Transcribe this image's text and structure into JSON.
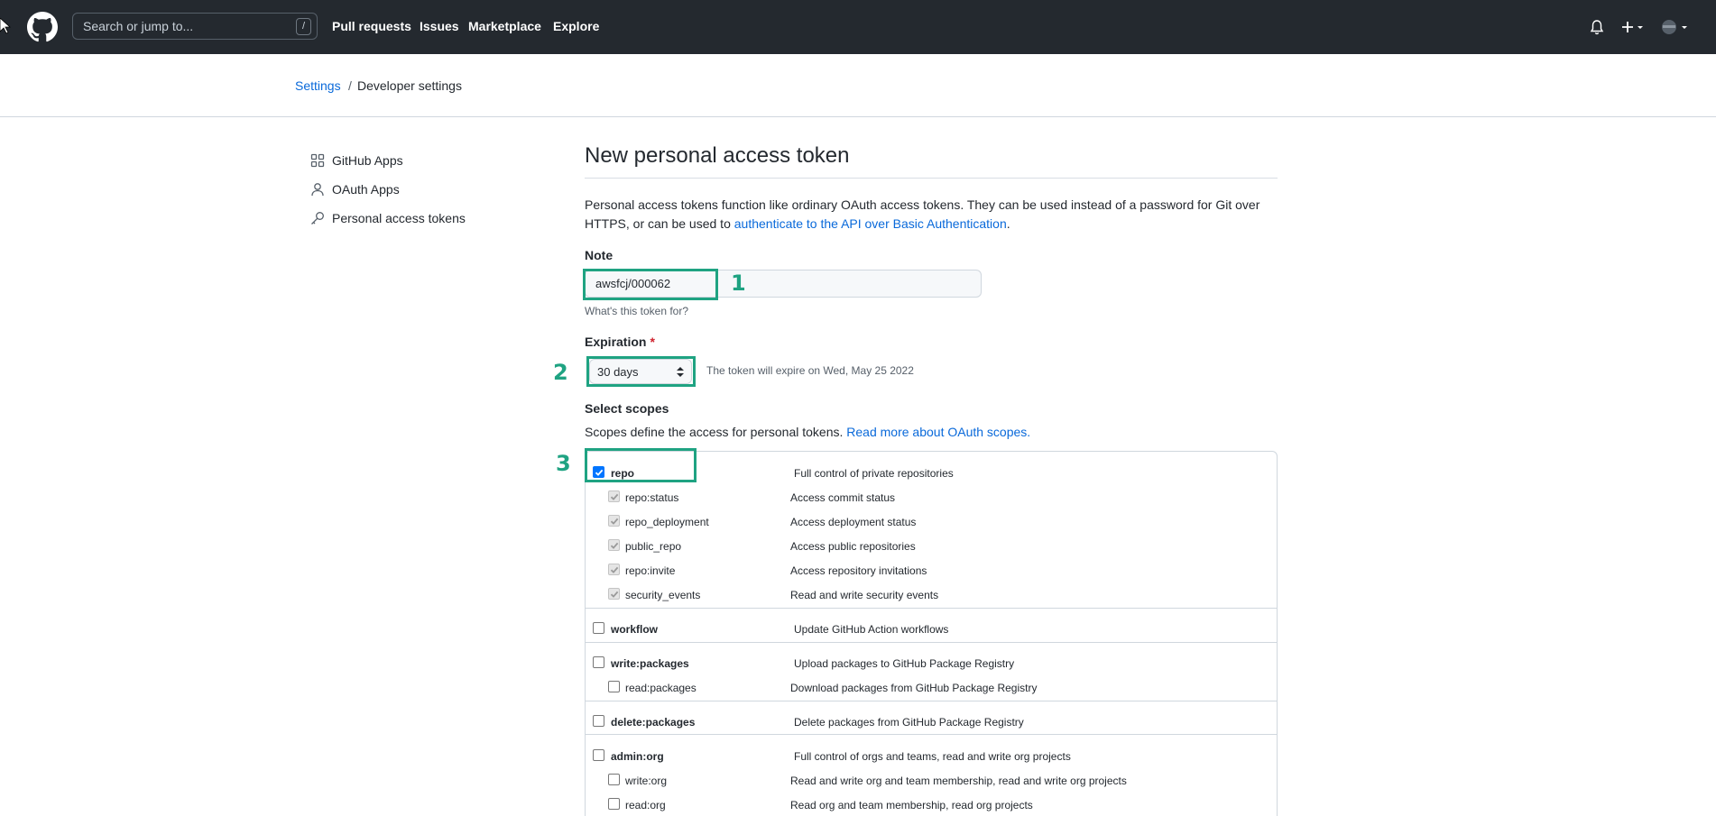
{
  "header": {
    "search_placeholder": "Search or jump to...",
    "search_shortcut": "/",
    "nav": [
      "Pull requests",
      "Issues",
      "Marketplace",
      "Explore"
    ]
  },
  "breadcrumb": {
    "settings": "Settings",
    "separator": "/",
    "current": "Developer settings"
  },
  "sidebar": {
    "items": [
      {
        "label": "GitHub Apps",
        "icon": "apps-icon"
      },
      {
        "label": "OAuth Apps",
        "icon": "person-icon"
      },
      {
        "label": "Personal access tokens",
        "icon": "key-icon"
      }
    ]
  },
  "main": {
    "title": "New personal access token",
    "description_part1": "Personal access tokens function like ordinary OAuth access tokens. They can be used instead of a password for Git over HTTPS, or can be used to ",
    "description_link": "authenticate to the API over Basic Authentication",
    "description_end": ".",
    "note_label": "Note",
    "note_value": "awsfcj/000062",
    "note_hint": "What's this token for?",
    "expiration_label": "Expiration",
    "expiration_required": "*",
    "expiration_value": "30 days",
    "expiration_note": "The token will expire on Wed, May 25 2022",
    "scopes_label": "Select scopes",
    "scopes_desc": "Scopes define the access for personal tokens. ",
    "scopes_link": "Read more about OAuth scopes."
  },
  "scopes": [
    {
      "name": "repo",
      "desc": "Full control of private repositories",
      "checked": true
    },
    {
      "name": "repo:status",
      "desc": "Access commit status",
      "checked": true,
      "disabled": true
    },
    {
      "name": "repo_deployment",
      "desc": "Access deployment status",
      "checked": true,
      "disabled": true
    },
    {
      "name": "public_repo",
      "desc": "Access public repositories",
      "checked": true,
      "disabled": true
    },
    {
      "name": "repo:invite",
      "desc": "Access repository invitations",
      "checked": true,
      "disabled": true
    },
    {
      "name": "security_events",
      "desc": "Read and write security events",
      "checked": true,
      "disabled": true
    },
    {
      "name": "workflow",
      "desc": "Update GitHub Action workflows",
      "checked": false
    },
    {
      "name": "write:packages",
      "desc": "Upload packages to GitHub Package Registry",
      "checked": false
    },
    {
      "name": "read:packages",
      "desc": "Download packages from GitHub Package Registry",
      "checked": false
    },
    {
      "name": "delete:packages",
      "desc": "Delete packages from GitHub Package Registry",
      "checked": false
    },
    {
      "name": "admin:org",
      "desc": "Full control of orgs and teams, read and write org projects",
      "checked": false
    },
    {
      "name": "write:org",
      "desc": "Read and write org and team membership, read and write org projects",
      "checked": false
    },
    {
      "name": "read:org",
      "desc": "Read org and team membership, read org projects",
      "checked": false
    }
  ],
  "annotations": [
    "1",
    "2",
    "3"
  ],
  "colors": {
    "header_bg": "#24292f",
    "link": "#0969da",
    "annotation": "#1fa382",
    "required": "#cf222e",
    "checkbox_checked": "#0075ff"
  }
}
